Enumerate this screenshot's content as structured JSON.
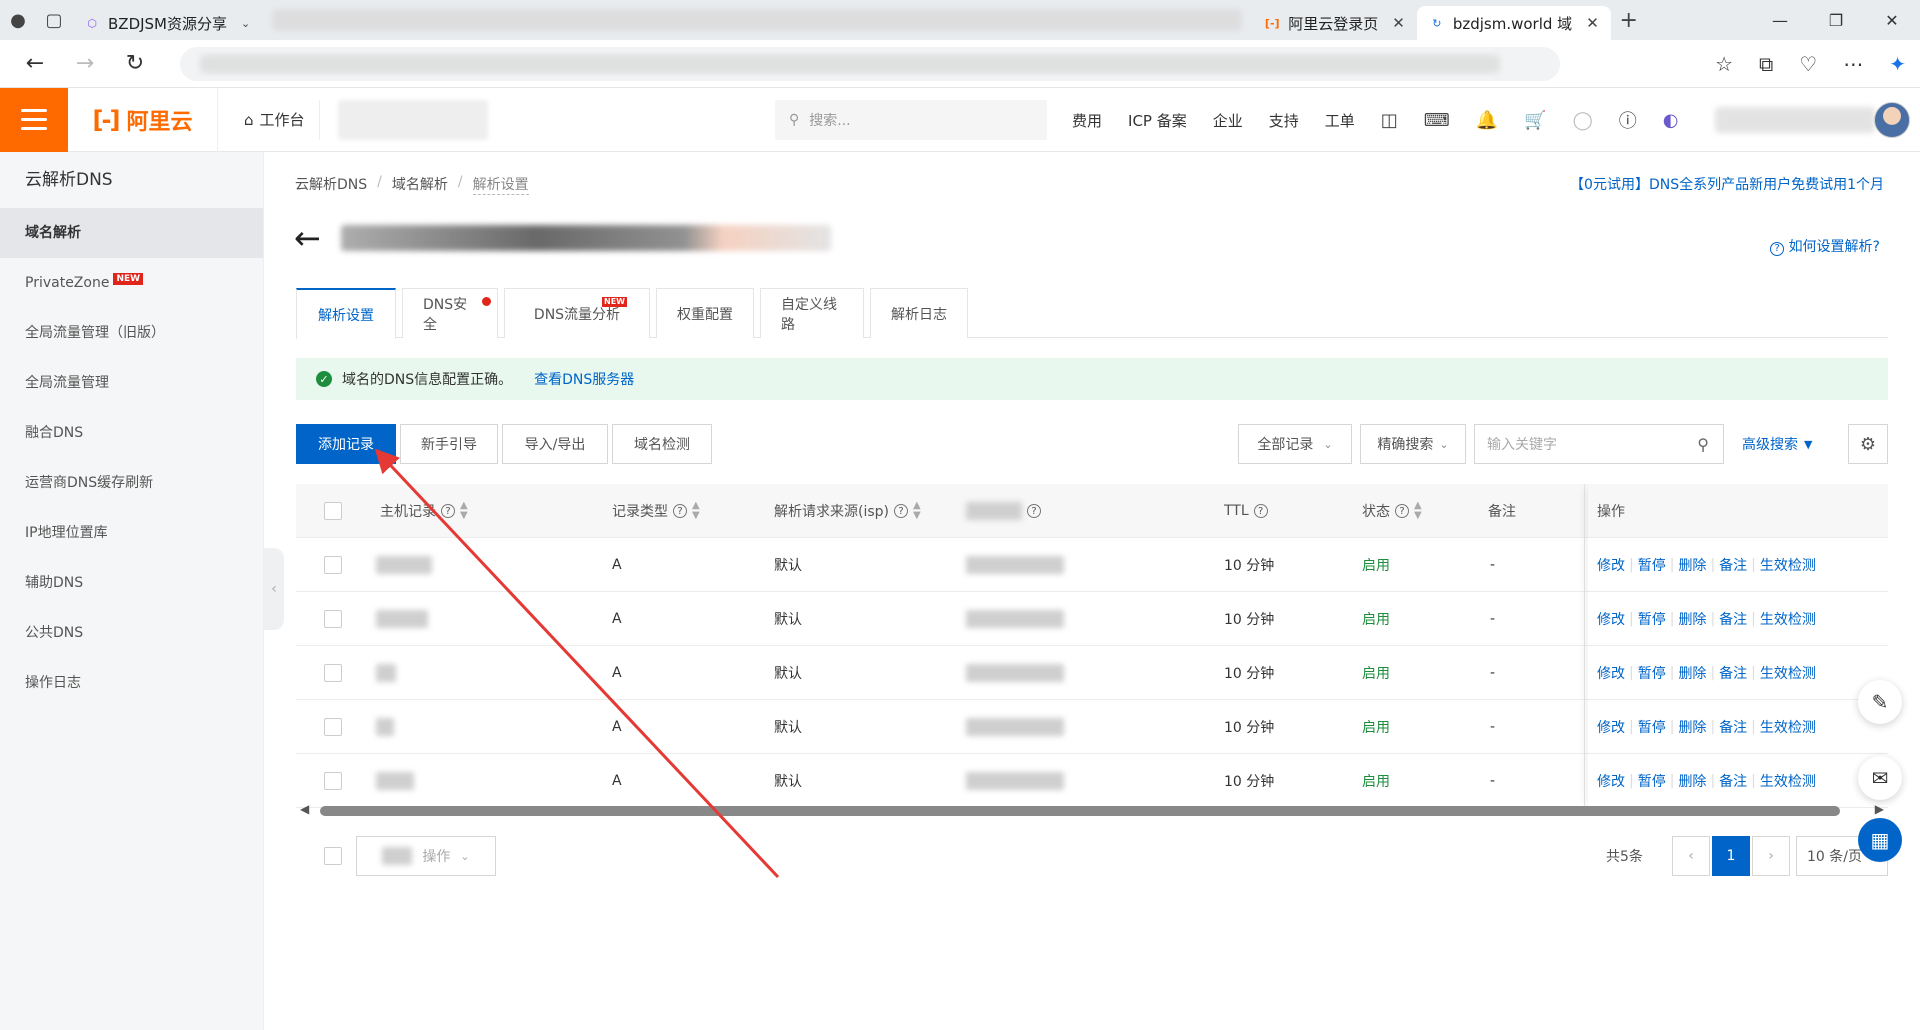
{
  "browser": {
    "tabs": [
      {
        "title": "BZDJSM资源分享",
        "active": false
      },
      {
        "title": "阿里云登录页",
        "active": false
      },
      {
        "title": "bzdjsm.world 域",
        "active": true
      }
    ]
  },
  "header": {
    "brand": "阿里云",
    "workbench": "工作台",
    "search_placeholder": "搜索...",
    "nav": [
      "费用",
      "ICP 备案",
      "企业",
      "支持",
      "工单"
    ]
  },
  "sidebar": {
    "title": "云解析DNS",
    "items": [
      {
        "label": "域名解析",
        "active": true,
        "badge": ""
      },
      {
        "label": "PrivateZone",
        "active": false,
        "badge": "NEW"
      },
      {
        "label": "全局流量管理（旧版）",
        "active": false,
        "badge": ""
      },
      {
        "label": "全局流量管理",
        "active": false,
        "badge": ""
      },
      {
        "label": "融合DNS",
        "active": false,
        "badge": ""
      },
      {
        "label": "运营商DNS缓存刷新",
        "active": false,
        "badge": ""
      },
      {
        "label": "IP地理位置库",
        "active": false,
        "badge": ""
      },
      {
        "label": "辅助DNS",
        "active": false,
        "badge": ""
      },
      {
        "label": "公共DNS",
        "active": false,
        "badge": ""
      },
      {
        "label": "操作日志",
        "active": false,
        "badge": ""
      }
    ]
  },
  "breadcrumb": [
    "云解析DNS",
    "域名解析",
    "解析设置"
  ],
  "promo": "【0元试用】DNS全系列产品新用户免费试用1个月",
  "help_link": "如何设置解析?",
  "tabs": [
    {
      "label": "解析设置",
      "active": true
    },
    {
      "label": "DNS安全",
      "active": false
    },
    {
      "label": "DNS流量分析",
      "active": false
    },
    {
      "label": "权重配置",
      "active": false
    },
    {
      "label": "自定义线路",
      "active": false
    },
    {
      "label": "解析日志",
      "active": false
    }
  ],
  "alert": {
    "text": "域名的DNS信息配置正确。",
    "link": "查看DNS服务器"
  },
  "toolbar": {
    "add": "添加记录",
    "guide": "新手引导",
    "import_export": "导入/导出",
    "check": "域名检测",
    "filter": "全部记录",
    "precise": "精确搜索",
    "keyword_placeholder": "输入关键字",
    "advanced": "高级搜索"
  },
  "table": {
    "headers": {
      "host": "主机记录",
      "type": "记录类型",
      "isp": "解析请求来源(isp)",
      "ttl": "TTL",
      "status": "状态",
      "remark": "备注",
      "ops": "操作"
    },
    "rows": [
      {
        "type": "A",
        "isp": "默认",
        "ttl": "10 分钟",
        "status": "启用",
        "remark": "-"
      },
      {
        "type": "A",
        "isp": "默认",
        "ttl": "10 分钟",
        "status": "启用",
        "remark": "-"
      },
      {
        "type": "A",
        "isp": "默认",
        "ttl": "10 分钟",
        "status": "启用",
        "remark": "-"
      },
      {
        "type": "A",
        "isp": "默认",
        "ttl": "10 分钟",
        "status": "启用",
        "remark": "-"
      },
      {
        "type": "A",
        "isp": "默认",
        "ttl": "10 分钟",
        "status": "启用",
        "remark": "-"
      }
    ],
    "ops": [
      "修改",
      "暂停",
      "删除",
      "备注",
      "生效检测"
    ]
  },
  "footer": {
    "batch": "操作",
    "total": "共5条",
    "current_page": "1",
    "page_size": "10 条/页"
  },
  "colors": {
    "accent": "#0064c8",
    "brand": "#ff6a00",
    "success": "#1e8e3e",
    "annotation": "#e53935"
  }
}
